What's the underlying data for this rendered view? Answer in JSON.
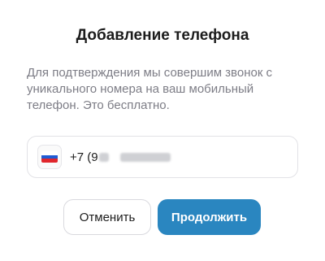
{
  "dialog": {
    "title": "Добавление телефона",
    "description": "Для подтверждения мы совершим звонок с уникального номера на ваш мобильный телефон. Это бесплатно."
  },
  "phone_field": {
    "country_icon": "russia-flag-icon",
    "flag_colors": [
      "#ffffff",
      "#1f5bd3",
      "#e0262c"
    ],
    "prefix": "+7 (9",
    "masked": true
  },
  "buttons": {
    "cancel_label": "Отменить",
    "continue_label": "Продолжить"
  },
  "colors": {
    "primary": "#2a86c0",
    "text": "#1c1c1c",
    "muted": "#7d7d86"
  }
}
